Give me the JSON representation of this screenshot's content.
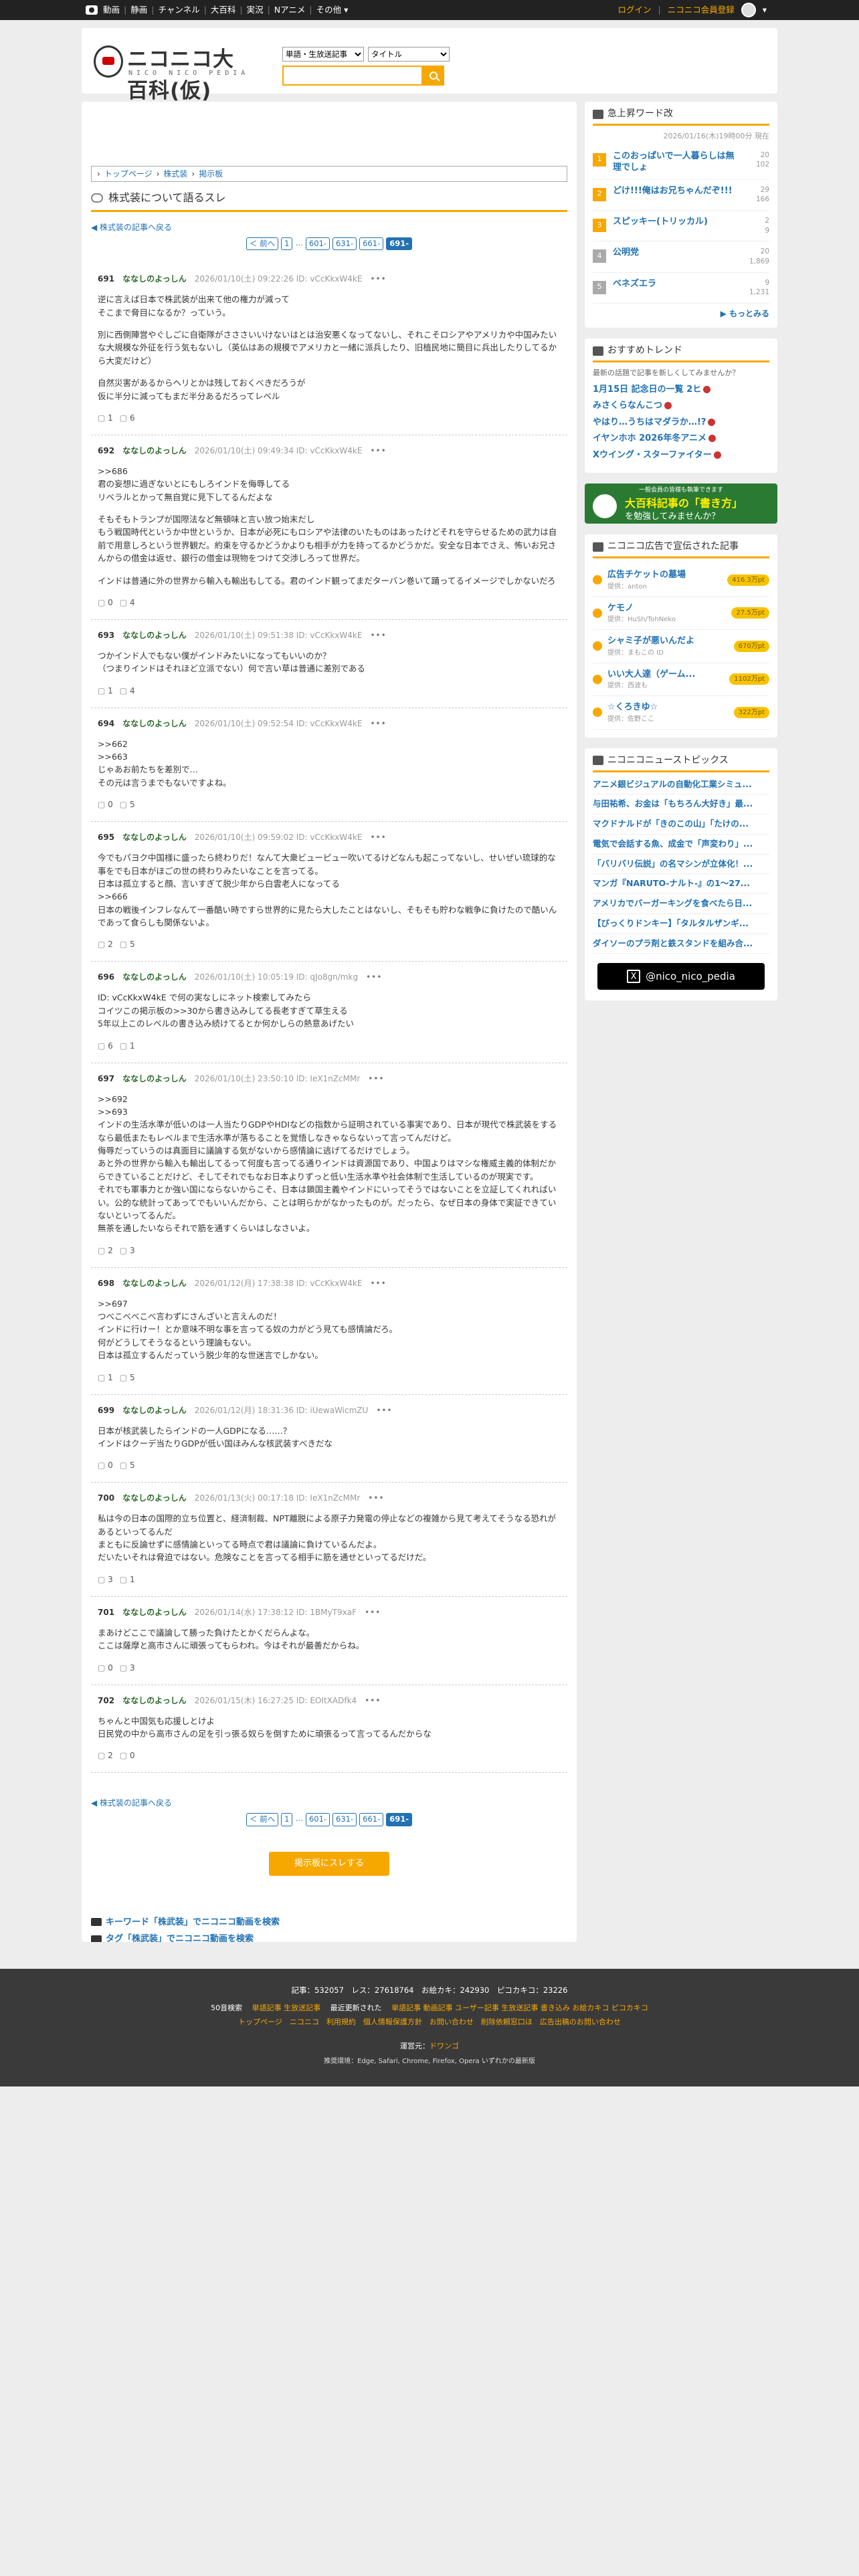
{
  "topbar": {
    "nav": [
      "動画",
      "静画",
      "チャンネル",
      "大百科",
      "実況",
      "Nアニメ",
      "その他 ▾"
    ],
    "login": "ログイン",
    "register": "ニコニコ会員登録"
  },
  "header": {
    "logo_title": "ニコニコ大百科(仮)",
    "logo_sub": "NICO NICO PEDIA",
    "select1": "単語・生放送記事",
    "select2": "タイトル"
  },
  "breadcrumb": [
    "トップページ",
    "株式装",
    "掲示板"
  ],
  "page_title": "株式装について語るスレ",
  "back_label": "株式装の記事へ戻る",
  "pager": {
    "prev": "＜ 前へ",
    "items": [
      "1",
      "…",
      "601-",
      "631-",
      "661-",
      "691-"
    ]
  },
  "posts": [
    {
      "num": "691",
      "name": "ななしのよっしん",
      "date": "2026/01/10(土) 09:22:26 ID: vCcKkxW4kE",
      "paragraphs": [
        "逆に言えば日本で株武装が出来て他の権力が減って\nそこまで脅目になるか？っていう。",
        "別に西側陣営やぐしごに自衛隊がさささいいけないはとは治安悪くなってないし、それこそロシアやアメリカや中国みたいな大規模な外征を行う気もないし（英仏はあの規模でアメリカと一緒に派兵したり、旧植民地に簡目に兵出したりしてるから大変だけど）",
        "自然災害があるからヘリとかは残しておくべきだろうが\n仮に半分に減ってもまだ半分あるだろってレベル"
      ],
      "votes": [
        "1",
        "6"
      ]
    },
    {
      "num": "692",
      "name": "ななしのよっしん",
      "date": "2026/01/10(土) 09:49:34 ID: vCcKkxW4kE",
      "paragraphs": [
        ">>686\n君の妄想に過ぎないとにもしろインドを侮辱してる\nリベラルとかって無自覚に見下してるんだよな",
        "そもそもトランプが国際法など無頓味と言い放つ始末だし\nもう戦国時代というか中世というか、日本が必死にもロシアや法律のいたものはあったけどそれを守らせるための武力は自前で用意しろという世界観だ。約束を守るかどうかよりも相手が力を持ってるかどうかだ。安全な日本でさえ、怖いお兄さんからの借金は返せ、銀行の借金は現物をつけて交渉しろって世界だ。",
        "インドは普通に外の世界から輸入も輸出もしてる。君のインド観ってまだターバン巻いて踊ってるイメージでしかないだろ"
      ],
      "votes": [
        "0",
        "4"
      ]
    },
    {
      "num": "693",
      "name": "ななしのよっしん",
      "date": "2026/01/10(土) 09:51:38 ID: vCcKkxW4kE",
      "paragraphs": [
        "つかインド人でもない僕がインドみたいになってもいいのか？\n（つまりインドはそれほど立派でない）何で言い草は普通に差別である"
      ],
      "votes": [
        "1",
        "4"
      ]
    },
    {
      "num": "694",
      "name": "ななしのよっしん",
      "date": "2026/01/10(土) 09:52:54 ID: vCcKkxW4kE",
      "paragraphs": [
        ">>662\n>>663\nじゃあお前たちを差別で…\nその元は言うまでもないですよね。"
      ],
      "votes": [
        "0",
        "5"
      ]
    },
    {
      "num": "695",
      "name": "ななしのよっしん",
      "date": "2026/01/10(土) 09:59:02 ID: vCcKkxW4kE",
      "paragraphs": [
        "今でもパヨク中国様に盛ったら終わりだ！なんて大衆ビューピュー吹いてるけどなんも起こってないし、せいぜい琉球的な事をでも日本がほごの世の終わりみたいなことを言ってる。\n日本は孤立すると顔、言いすぎて脱少年から白雲老人になってる\n>>666\n日本の戦後インフレなんて一番酷い時ですら世界的に見たら大したことはないし、そもそも貯わな戦争に負けたので酷いんであって食らしも関係ないよ。"
      ],
      "votes": [
        "2",
        "5"
      ]
    },
    {
      "num": "696",
      "name": "ななしのよっしん",
      "date": "2026/01/10(土) 10:05:19 ID: qJo8gn/mkg",
      "paragraphs": [
        "ID: vCcKkxW4kE で何の実なしにネット検索してみたら\nコイツこの掲示板の>>30から書き込みしてる長老すぎて草生える\n5年以上このレベルの書き込み続けてるとか何かしらの熱意あげたい"
      ],
      "votes": [
        "6",
        "1"
      ]
    },
    {
      "num": "697",
      "name": "ななしのよっしん",
      "date": "2026/01/10(土) 23:50:10 ID: IeX1nZcMMr",
      "paragraphs": [
        ">>692\n>>693\nインドの生活水準が低いのは一人当たりGDPやHDIなどの指数から証明されている事実であり、日本が現代で株武装をするなら最低またもレベルまで生活水準が落ちることを覚悟しなきゃならないって言ってんだけど。\n侮辱だっていうのは真面目に議論する気がないから感情論に逃げてるだけでしょう。\nあと外の世界から輸入も輸出してるって何度も言ってる通りインドは資源国であり、中国よりはマシな権威主義的体制だからできていることだけど、そしてそれでもなお日本よりずっと低い生活水準や社会体制で生活しているのが現実です。\nそれでも軍事力とか強い国にならないからこそ、日本は鎖国主義やインドにいってそうではないことを立証してくれればいい。公的な統計ってあってでもいいんだから、ことは明らかがなかったものが。だったら、なぜ日本の身体で実証できていないといってるんだ。\n無茶を通したいならそれで筋を通すくらいはしなさいよ。"
      ],
      "votes": [
        "2",
        "3"
      ]
    },
    {
      "num": "698",
      "name": "ななしのよっしん",
      "date": "2026/01/12(月) 17:38:38 ID: vCcKkxW4kE",
      "paragraphs": [
        ">>697\nつべこべべこべ言わずにさんざいと言えんのだ！\nインドに行けー！とか意味不明な事を言ってる奴の力がどう見ても感情論だろ。\n何がどうしてそうなるという理論もない。\n日本は孤立するんだっていう脱少年的な世迷言でしかない。"
      ],
      "votes": [
        "1",
        "5"
      ]
    },
    {
      "num": "699",
      "name": "ななしのよっしん",
      "date": "2026/01/12(月) 18:31:36 ID: iUewaWicmZU",
      "paragraphs": [
        "日本が核武装したらインドの一人GDPになる……？\nインドはクーデ当たりGDPが低い国ほみんな核武装すべきだな"
      ],
      "votes": [
        "0",
        "5"
      ]
    },
    {
      "num": "700",
      "name": "ななしのよっしん",
      "date": "2026/01/13(火) 00:17:18 ID: IeX1nZcMMr",
      "paragraphs": [
        "私は今の日本の国際的立ち位置と、経済制裁、NPT離脱による原子力発電の停止などの複雑から見て考えてそうなる恐れがあるといってるんだ\nまともに反論せずに感情論といってる時点で君は議論に負けているんだよ。\nだいたいそれは脅迫ではない。危険なことを言ってる相手に筋を通せといってるだけだ。"
      ],
      "votes": [
        "3",
        "1"
      ]
    },
    {
      "num": "701",
      "name": "ななしのよっしん",
      "date": "2026/01/14(水) 17:38:12 ID: 1BMyT9xaF",
      "paragraphs": [
        "まあけどここで議論して勝った負けたとかくだらんよな。\nここは薩摩と高市さんに頑張ってもらわれ。今はそれが最善だからね。"
      ],
      "votes": [
        "0",
        "3"
      ]
    },
    {
      "num": "702",
      "name": "ななしのよっしん",
      "date": "2026/01/15(木) 16:27:25 ID: EOItXADfk4",
      "paragraphs": [
        "ちゃんと中国気も応援しとけよ\n日民党の中から高市さんの足を引っ張る奴らを倒すために頑張るって言ってるんだからな"
      ],
      "votes": [
        "2",
        "0"
      ]
    }
  ],
  "show_all_label": "掲示板にスレする",
  "search_links": [
    "キーワード「株武装」でニコニコ動画を検索",
    "タグ「株武装」でニコニコ動画を検索"
  ],
  "side": {
    "trend_title": "急上昇ワード改",
    "trend_date": "2026/01/16(木)19時00分 現在",
    "trends": [
      {
        "rank": "1",
        "title": "このおっぱいで一人暮らしは無理でしょ",
        "a": "20",
        "b": "102"
      },
      {
        "rank": "2",
        "title": "どけ!!!俺はお兄ちゃんだぞ!!!",
        "a": "29",
        "b": "166"
      },
      {
        "rank": "3",
        "title": "スピッキー(トリッカル)",
        "a": "2",
        "b": "9"
      },
      {
        "rank": "4",
        "title": "公明党",
        "a": "20",
        "b": "1,869"
      },
      {
        "rank": "5",
        "title": "ベネズエラ",
        "a": "9",
        "b": "1,231"
      }
    ],
    "trend_more": "もっとみる",
    "reco_title": "おすすめトレンド",
    "reco_sub": "最新の話題で記事を新しくしてみませんか？",
    "reco_items": [
      "1月15日 記念日の一覧 2ヒ",
      "みさくらなんこつ",
      "やはり…うちはマダラか…!?",
      "イヤンホホ 2026年冬アニメ",
      "Xウイング・スターファイター"
    ],
    "banner_small": "一般会員の皆様も執筆できます",
    "banner_big": "大百科記事の「書き方」",
    "banner_next": "を勉強してみませんか？",
    "ad_title": "ニコニコ広告で宣伝された記事",
    "ads": [
      {
        "title": "広告チケットの墓場",
        "by": "提供：anton",
        "pt": "416.3万pt"
      },
      {
        "title": "ケモノ",
        "by": "提供：HuSh/TohNeko",
        "pt": "27.5万pt"
      },
      {
        "title": "シャミ子が悪いんだよ",
        "by": "提供：まもこの ID",
        "pt": "670万pt"
      },
      {
        "title": "いい大人達（ゲーム...",
        "by": "提供：西波も",
        "pt": "1102万pt"
      },
      {
        "title": "☆くろきゆ☆",
        "by": "提供：佐野ここ",
        "pt": "322万pt"
      }
    ],
    "news_title": "ニコニコニューストピックス",
    "news": [
      "アニメ銀ビジュアルの自動化工業シミュ...",
      "与田祐希、お金は「もちろん大好き」最...",
      "マクドナルドが「きのこの山」「たけの...",
      "電気で会話する魚、成金で「声変わり」...",
      "「バリバリ伝説」の名マシンが立体化！...",
      "マンガ『NARUTO-ナルト-』の1～27...",
      "アメリカでバーガーキングを食べたら日...",
      "【びっくりドンキー】「タルタルザンギ...",
      "ダイソーのプラ剤と鉄スタンドを組み合..."
    ],
    "x_handle": "@nico_nico_pedia"
  },
  "footer": {
    "stats": "記事：532057　レス：27618764　お絵カキ：242930　ピコカキコ：23226",
    "line2_prefix": "50音検索",
    "line2_items": "単語記事 生放送記事",
    "line2_recent": "最近更新された",
    "line2_more": "単語記事 動画記事 ユーザー記事 生放送記事 書き込み お絵カキコ ピコカキコ",
    "line3": "トップページ　ニコニコ　利用規約　個人情報保護方針　お問い合わせ　削除依頼窓口ほ　広告出稿のお問い合わせ",
    "operator_label": "運営元：",
    "operator": "ドワンゴ",
    "env": "推奨環境：Edge, Safari, Chrome, Firefox, Opera いずれかの最新版"
  }
}
